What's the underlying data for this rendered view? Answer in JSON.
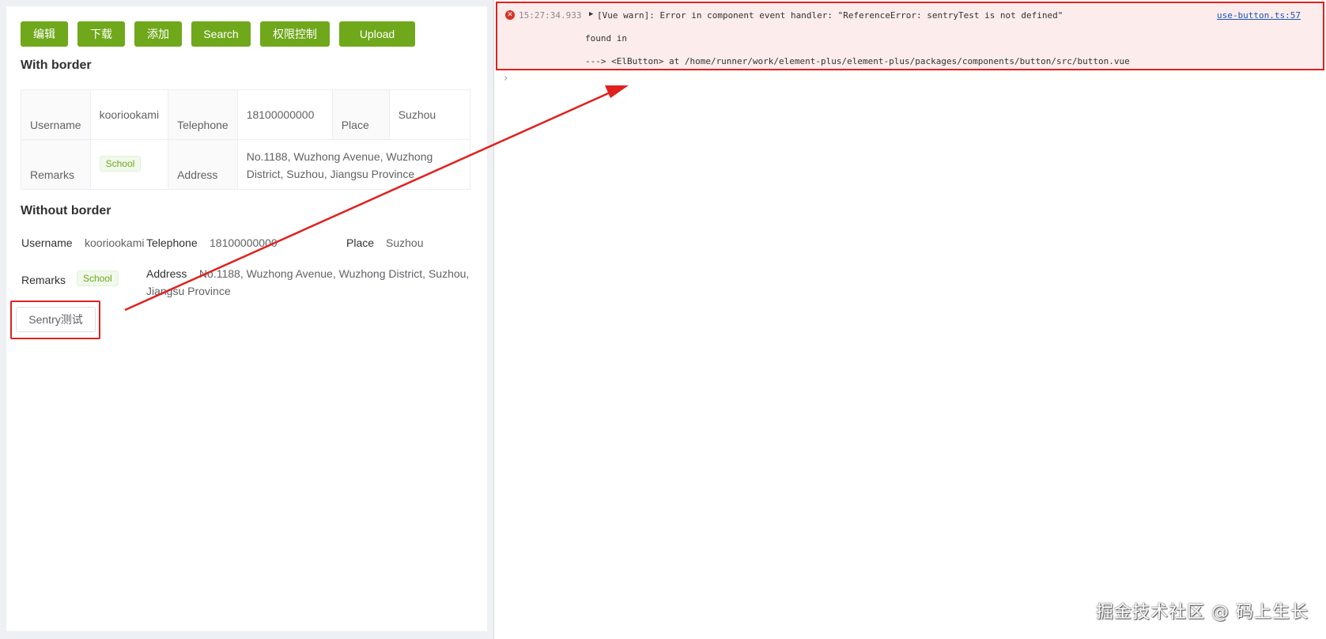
{
  "toolbar": {
    "buttons": [
      "编辑",
      "下载",
      "添加",
      "Search",
      "权限控制",
      "Upload"
    ]
  },
  "with_border": {
    "title": "With border",
    "rows": [
      [
        {
          "label": "Username",
          "value": "kooriookami"
        },
        {
          "label": "Telephone",
          "value": "18100000000"
        },
        {
          "label": "Place",
          "value": "Suzhou"
        }
      ],
      [
        {
          "label": "Remarks",
          "tag": "School"
        },
        {
          "label": "Address",
          "value": "No.1188, Wuzhong Avenue, Wuzhong District, Suzhou, Jiangsu Province"
        }
      ]
    ]
  },
  "without_border": {
    "title": "Without border",
    "username_label": "Username",
    "username_value": "kooriookami",
    "telephone_label": "Telephone",
    "telephone_value": "18100000000",
    "place_label": "Place",
    "place_value": "Suzhou",
    "remarks_label": "Remarks",
    "remarks_tag": "School",
    "address_label": "Address",
    "address_value": "No.1188, Wuzhong Avenue, Wuzhong District, Suzhou, Jiangsu Province"
  },
  "sentry_button_label": "Sentry测试",
  "console": {
    "timestamp": "15:27:34.933",
    "message": "[Vue warn]: Error in component event handler: \"ReferenceError: sentryTest is not defined\"",
    "source_link": "use-button.ts:57",
    "found_in": "found in",
    "trace": "---> <ElButton> at /home/runner/work/element-plus/element-plus/packages/components/button/src/button.vue"
  },
  "watermark": "掘金技术社区 @ 码上生长",
  "colors": {
    "primary_green": "#6fa81b",
    "annotation_red": "#e0211e",
    "error_bg": "#fdecec"
  }
}
